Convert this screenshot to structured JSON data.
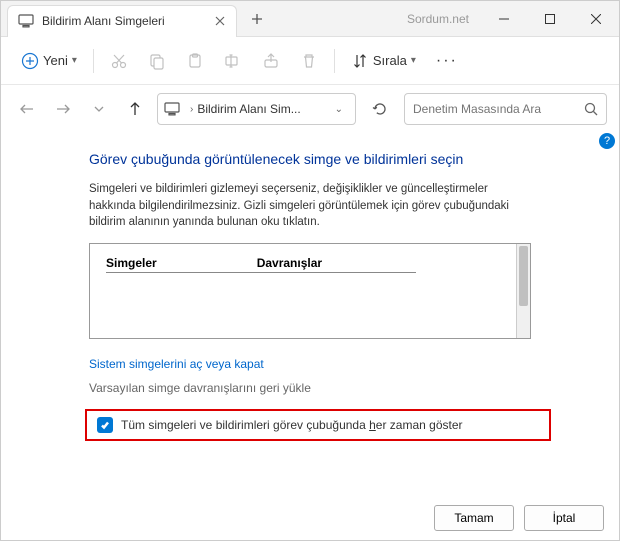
{
  "watermark": "Sordum.net",
  "tab": {
    "title": "Bildirim Alanı Simgeleri"
  },
  "toolbar": {
    "new_label": "Yeni",
    "sort_label": "Sırala"
  },
  "nav": {
    "breadcrumb": "Bildirim Alanı Sim...",
    "search_placeholder": "Denetim Masasında Ara"
  },
  "page": {
    "heading": "Görev çubuğunda görüntülenecek simge ve bildirimleri seçin",
    "description": "Simgeleri ve bildirimleri gizlemeyi seçerseniz, değişiklikler ve güncelleştirmeler hakkında bilgilendirilmezsiniz. Gizli simgeleri görüntülemek için görev çubuğundaki bildirim alanının yanında bulunan oku tıklatın.",
    "th_icons": "Simgeler",
    "th_behaviors": "Davranışlar",
    "link_system_icons": "Sistem simgelerini aç veya kapat",
    "link_restore_defaults": "Varsayılan simge davranışlarını geri yükle",
    "checkbox_label_pre": "Tüm simgeleri ve bildirimleri görev çubuğunda ",
    "checkbox_label_u": "h",
    "checkbox_label_post": "er zaman göster"
  },
  "footer": {
    "ok": "Tamam",
    "cancel": "İptal"
  }
}
